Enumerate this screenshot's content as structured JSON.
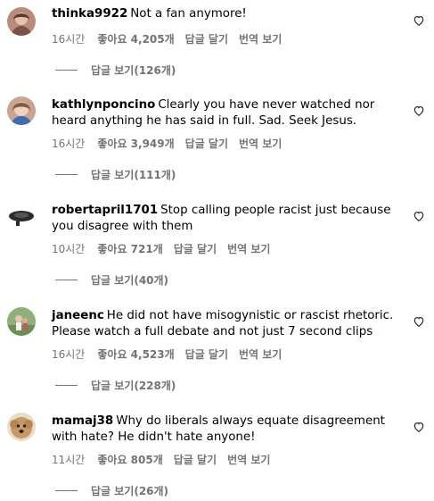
{
  "comments": [
    {
      "username": "thinka9922",
      "text": "Not a fan anymore!",
      "time": "16시간",
      "likes": "좋아요 4,205개",
      "reply": "답글 달기",
      "translate": "번역 보기",
      "view_replies": "답글 보기(126개)"
    },
    {
      "username": "kathlynponcino",
      "text": "Clearly you have never watched nor heard anything he has said in full. Sad. Seek Jesus.",
      "time": "16시간",
      "likes": "좋아요 3,949개",
      "reply": "답글 달기",
      "translate": "번역 보기",
      "view_replies": "답글 보기(111개)"
    },
    {
      "username": "robertapril1701",
      "text": "Stop calling people racist just because you disagree with them",
      "time": "10시간",
      "likes": "좋아요 721개",
      "reply": "답글 달기",
      "translate": "번역 보기",
      "view_replies": "답글 보기(40개)"
    },
    {
      "username": "janeenc",
      "text": "He did not have misogynistic or rascist rhetoric. Please watch a full debate and not just 7 second clips",
      "time": "16시간",
      "likes": "좋아요 4,523개",
      "reply": "답글 달기",
      "translate": "번역 보기",
      "view_replies": "답글 보기(228개)"
    },
    {
      "username": "mamaj38",
      "text": "Why do liberals always equate disagreement with hate? He didn't hate anyone!",
      "time": "11시간",
      "likes": "좋아요 805개",
      "reply": "답글 달기",
      "translate": "번역 보기",
      "view_replies": "답글 보기(26개)"
    }
  ],
  "icons": {
    "like": "heart-outline-icon"
  }
}
